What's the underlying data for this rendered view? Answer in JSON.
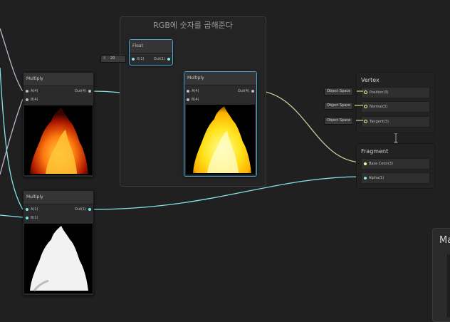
{
  "group": {
    "title": "RGB에 숫자를 곱해준다"
  },
  "float_node": {
    "title": "Float",
    "input_label": "X(1)",
    "output_label": "Out(1)",
    "field_label": "X",
    "field_value": "20"
  },
  "multiply_nodes": [
    {
      "title": "Multiply",
      "input_a": "A(4)",
      "input_b": "B(4)",
      "output": "Out(4)"
    },
    {
      "title": "Multiply",
      "input_a": "A(4)",
      "input_b": "B(4)",
      "output": "Out(4)"
    },
    {
      "title": "Multiply",
      "input_a": "A(1)",
      "input_b": "B(1)",
      "output": "Out(1)"
    }
  ],
  "vertex": {
    "title": "Vertex",
    "blocks": [
      {
        "label": "Position(3)",
        "space": "Object Space"
      },
      {
        "label": "Normal(3)",
        "space": "Object Space"
      },
      {
        "label": "Tangent(3)",
        "space": "Object Space"
      }
    ]
  },
  "fragment": {
    "title": "Fragment",
    "blocks": [
      {
        "label": "Base Color(3)"
      },
      {
        "label": "Alpha(1)"
      }
    ]
  },
  "side_panel": {
    "title": "Ma"
  },
  "colors": {
    "vec4_port": "#c5b1cb",
    "vec1_port": "#84e4e7",
    "vec3_port": "#f6ff9a",
    "selection": "#44a7d6"
  }
}
